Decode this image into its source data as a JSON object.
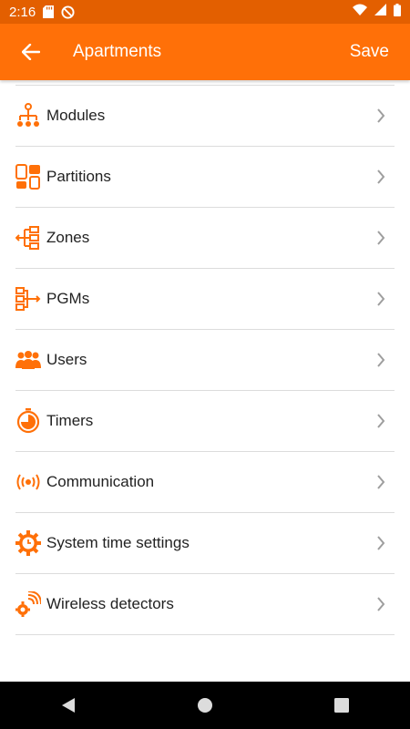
{
  "status_bar": {
    "time": "2:16"
  },
  "app_bar": {
    "title": "Apartments",
    "save_label": "Save"
  },
  "accent_color": "#ff7008",
  "menu": [
    {
      "label": "Modules",
      "icon": "modules-icon"
    },
    {
      "label": "Partitions",
      "icon": "partitions-icon"
    },
    {
      "label": "Zones",
      "icon": "zones-icon"
    },
    {
      "label": "PGMs",
      "icon": "pgms-icon"
    },
    {
      "label": "Users",
      "icon": "users-icon"
    },
    {
      "label": "Timers",
      "icon": "timer-icon"
    },
    {
      "label": "Communication",
      "icon": "communication-icon"
    },
    {
      "label": "System time settings",
      "icon": "system-time-icon"
    },
    {
      "label": "Wireless detectors",
      "icon": "wireless-detectors-icon"
    }
  ]
}
